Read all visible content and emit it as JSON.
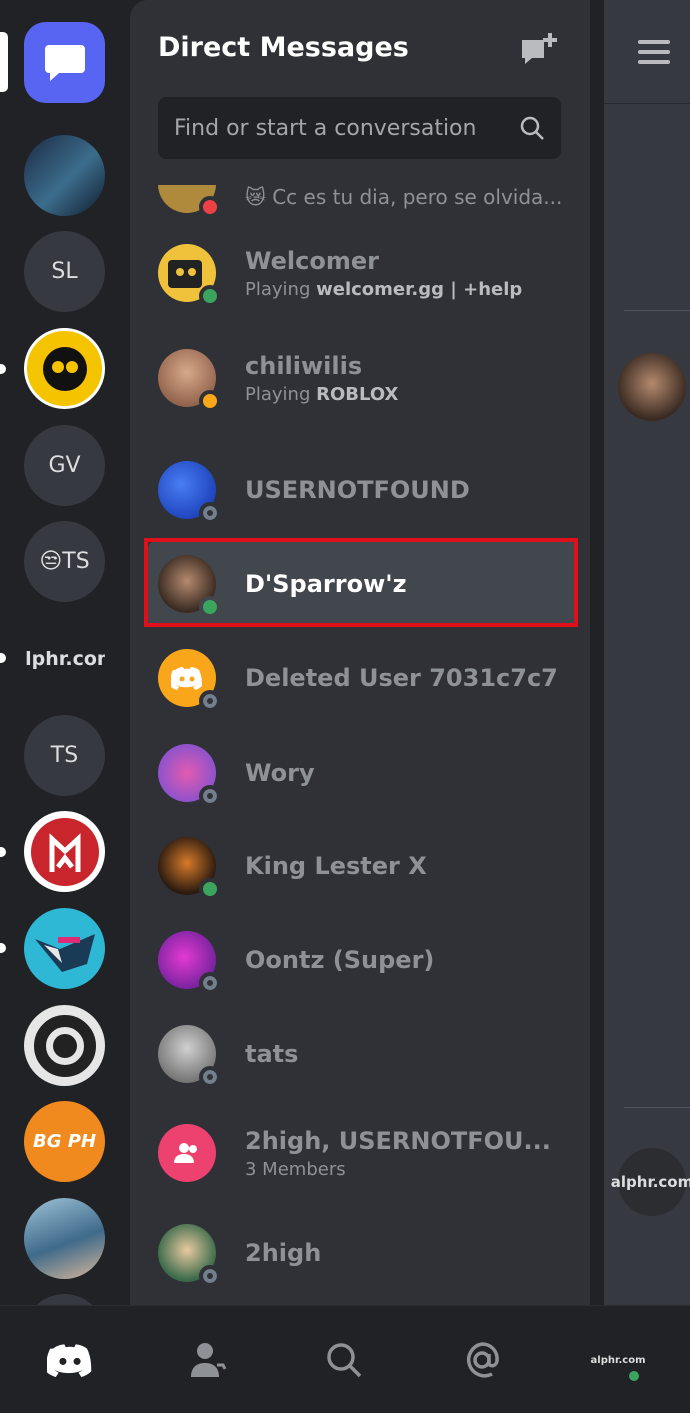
{
  "header": {
    "title": "Direct Messages",
    "search_placeholder": "Find or start a conversation"
  },
  "servers": [
    {
      "label": "",
      "kind": "photo-code"
    },
    {
      "label": "SL"
    },
    {
      "label": "",
      "kind": "brawl-icon"
    },
    {
      "label": "GV"
    },
    {
      "label": "😒TS"
    },
    {
      "label": "alphr.com"
    },
    {
      "label": "TS"
    },
    {
      "label": "",
      "kind": "red-logo"
    },
    {
      "label": "",
      "kind": "mrbeast"
    },
    {
      "label": "",
      "kind": "ring"
    },
    {
      "label": "BG PH"
    },
    {
      "label": "",
      "kind": "camera-photo"
    }
  ],
  "conversations": [
    {
      "name": "",
      "sub": "😿 Cc es tu dia, pero se olvida...",
      "status": "dnd"
    },
    {
      "name": "Welcomer",
      "sub_prefix": "Playing ",
      "sub_bold": "welcomer.gg | +help",
      "status": "on"
    },
    {
      "name": "chiliwilis",
      "sub_prefix": "Playing ",
      "sub_bold": "ROBLOX",
      "status": "idle"
    },
    {
      "name": "USERNOTFOUND",
      "status": "off"
    },
    {
      "name": "D'Sparrow'z",
      "status": "on",
      "selected": true
    },
    {
      "name": "Deleted User 7031c7c7",
      "status": "off"
    },
    {
      "name": "Wory",
      "status": "off"
    },
    {
      "name": "King Lester X",
      "status": "on"
    },
    {
      "name": "Oontz (Super)",
      "status": "off"
    },
    {
      "name": "tats",
      "status": "off"
    },
    {
      "name": "2high, USERNOTFOU...",
      "sub": "3 Members"
    },
    {
      "name": "2high",
      "status": "off"
    }
  ],
  "peek": {
    "avatar_text": "alphr.com"
  },
  "nav": {
    "profile_text": "alphr.com"
  },
  "colors": {
    "accent": "#5865f2",
    "online": "#3ba55d",
    "highlight": "#e0101a"
  }
}
